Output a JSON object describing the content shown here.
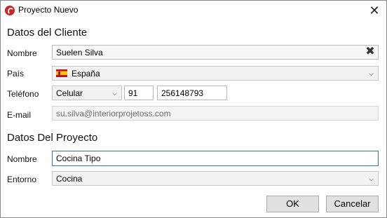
{
  "window": {
    "title": "Proyecto Nuevo"
  },
  "cliente": {
    "section_title": "Datos del Cliente",
    "nombre_label": "Nombre",
    "nombre_value": "Suelen Silva",
    "pais_label": "País",
    "pais_value": "España",
    "telefono_label": "Teléfono",
    "telefono_tipo": "Celular",
    "telefono_prefijo": "91",
    "telefono_numero": "256148793",
    "email_label": "E-mail",
    "email_value": "su.silva@interiorprojetoss.com"
  },
  "proyecto": {
    "section_title": "Datos Del Proyecto",
    "nombre_label": "Nombre",
    "nombre_value": "Cocina Tipo",
    "entorno_label": "Entorno",
    "entorno_value": "Cocina"
  },
  "buttons": {
    "ok": "OK",
    "cancel": "Cancelar"
  },
  "colors": {
    "accent_focus": "#2f6fd1",
    "app_icon": "#d02020"
  },
  "icons": {
    "app": "app-logo-icon",
    "close": "close-icon",
    "clear": "clear-icon",
    "dropdown": "chevron-down-icon",
    "flag": "spain-flag-icon"
  }
}
